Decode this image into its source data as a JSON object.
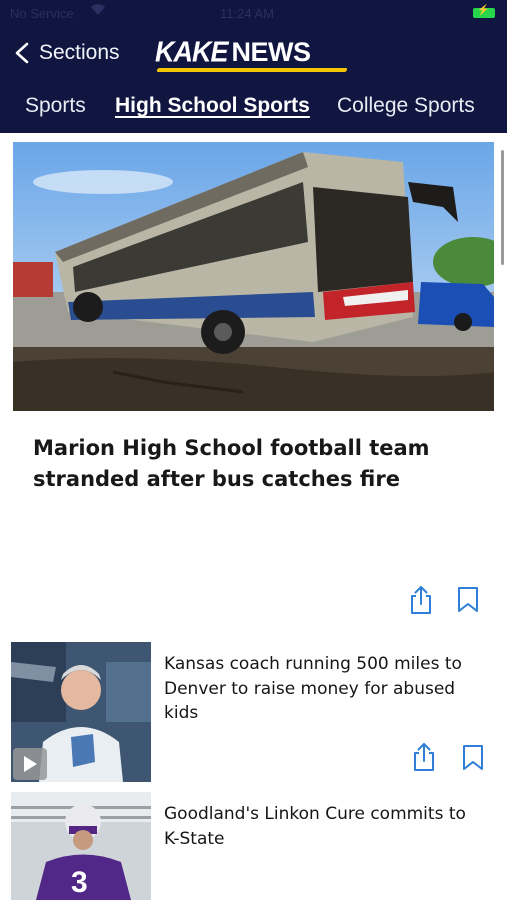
{
  "status_bar": {
    "carrier": "No Service",
    "time": "11:24 AM"
  },
  "nav": {
    "back_label": "Sections",
    "logo_primary": "KAKE",
    "logo_secondary": "NEWS"
  },
  "tabs": [
    {
      "label": "Sports",
      "active": false
    },
    {
      "label": "High School Sports",
      "active": true
    },
    {
      "label": "College Sports",
      "active": false
    }
  ],
  "hero": {
    "title": "Marion High School football team stranded after bus catches fire",
    "image": "burned-school-bus-photo"
  },
  "stories": [
    {
      "title": "Kansas coach running 500 miles to Denver to raise money for abused kids",
      "image": "coach-photo",
      "has_video": true
    },
    {
      "title": "Goodland's Linkon Cure commits to K-State",
      "image": "football-player-photo",
      "has_video": false
    }
  ],
  "icons": {
    "back": "chevron-left-icon",
    "share": "share-icon",
    "bookmark": "bookmark-icon",
    "play": "play-icon"
  },
  "colors": {
    "header_bg": "#101640",
    "accent_blue": "#2f7fd6",
    "logo_swoosh": "#f2c500",
    "battery": "#27d64a"
  }
}
